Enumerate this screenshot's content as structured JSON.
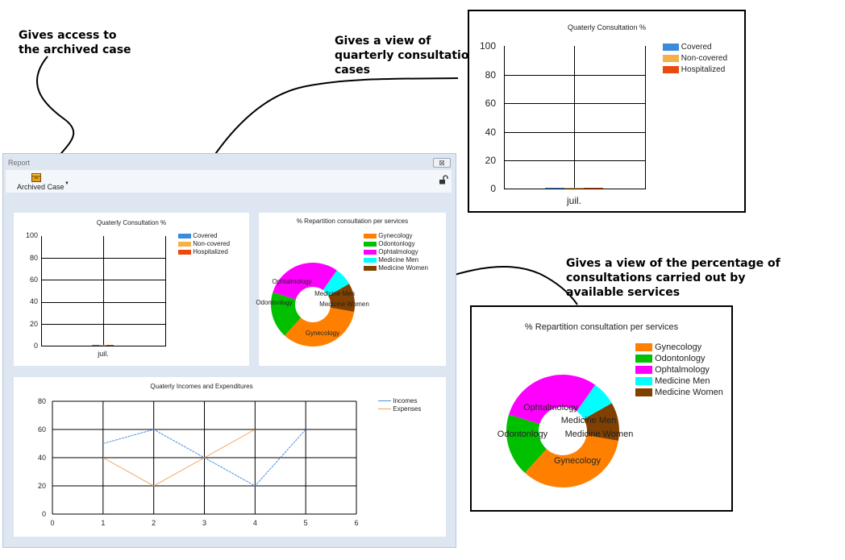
{
  "annotations": {
    "archive": [
      "Gives access to",
      "the archived case"
    ],
    "quarterly": [
      "Gives a view of",
      "quarterly consultation",
      "cases"
    ],
    "percentage": [
      "Gives a view of the percentage of",
      "consultations carried out by",
      "available services"
    ]
  },
  "window": {
    "title": "Report",
    "close_glyph": "⊠",
    "toolbar": {
      "archive_label": "Archived Case",
      "dropdown_glyph": "▼"
    }
  },
  "colors": {
    "covered": "#3b8bdc",
    "non_covered": "#f4b04a",
    "hospitalized": "#e84a10",
    "gynecology": "#ff8000",
    "odontonlogy": "#00c000",
    "ophtalmology": "#ff00ff",
    "medicine_men": "#00ffff",
    "medicine_women": "#804000",
    "incomes": "#4a90d9",
    "expenses": "#f2a35b"
  },
  "icons": {
    "archive": "box-icon",
    "lock": "unlock-icon"
  },
  "chart_data": [
    {
      "id": "quarterly-consultation",
      "type": "bar",
      "title": "Quaterly Consultation %",
      "categories": [
        "juil."
      ],
      "series": [
        {
          "name": "Covered",
          "values": [
            0
          ]
        },
        {
          "name": "Non-covered",
          "values": [
            0
          ]
        },
        {
          "name": "Hospitalized",
          "values": [
            0
          ]
        }
      ],
      "ylim": [
        0,
        100
      ],
      "yticks": [
        "0",
        "20",
        "40",
        "60",
        "80",
        "100"
      ],
      "legend": "right",
      "grid": true
    },
    {
      "id": "repartition",
      "type": "pie",
      "title": "% Repartition consultation per services",
      "categories": [
        "Gynecology",
        "Odontonlogy",
        "Ophtalmology",
        "Medicine Men",
        "Medicine Women"
      ],
      "values": [
        34,
        18,
        30,
        7,
        11
      ],
      "legend": "right"
    },
    {
      "id": "incomes-expenditures",
      "type": "line",
      "title": "Quaterly Incomes and Expenditures",
      "x": [
        1,
        2,
        3,
        4,
        5
      ],
      "series": [
        {
          "name": "Incomes",
          "values": [
            50,
            60,
            40,
            20,
            60
          ]
        },
        {
          "name": "Expenses",
          "values": [
            40,
            20,
            40,
            60,
            null
          ]
        }
      ],
      "xlim": [
        0,
        6
      ],
      "ylim": [
        0,
        80
      ],
      "xticks": [
        "0",
        "1",
        "2",
        "3",
        "4",
        "5",
        "6"
      ],
      "yticks": [
        "0",
        "20",
        "40",
        "60",
        "80"
      ],
      "legend": "right",
      "grid": true
    }
  ]
}
